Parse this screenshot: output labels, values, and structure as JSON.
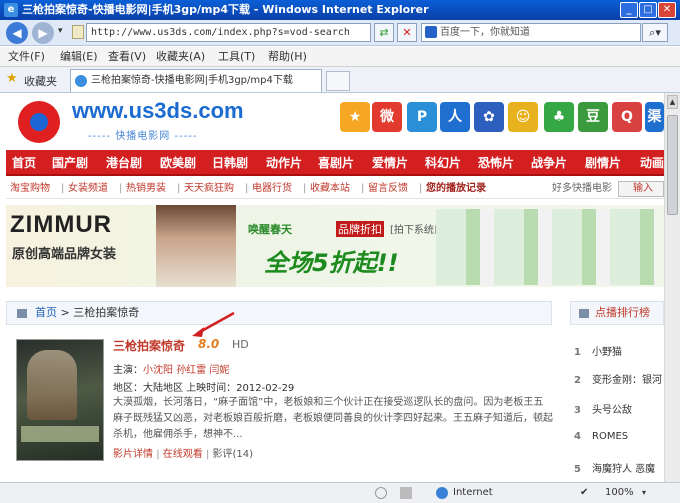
{
  "window": {
    "title": "三枪拍案惊奇-快播电影网|手机3gp/mp4下载 - Windows Internet Explorer"
  },
  "address_bar": {
    "url": "http://www.us3ds.com/index.php?s=vod-search",
    "search_placeholder": "百度一下，你就知道"
  },
  "menu": [
    "文件(F)",
    "编辑(E)",
    "查看(V)",
    "收藏夹(A)",
    "工具(T)",
    "帮助(H)"
  ],
  "favorites": {
    "label": "收藏夹",
    "tab_title": "三枪拍案惊奇-快播电影网|手机3gp/mp4下载"
  },
  "site": {
    "url_text": "www.us3ds.com",
    "slogan": "----- 快播电影网 -----",
    "icons": [
      "qzone-icon",
      "weibo-icon",
      "pengyou-icon",
      "renren-icon",
      "baidu-icon",
      "sohu-icon",
      "kaixin-icon",
      "douban-icon",
      "tqq-icon",
      "more-icon"
    ],
    "icon_colors": [
      "#f5a623",
      "#e23a2e",
      "#2a8fd6",
      "#1f6fd0",
      "#2d5fbf",
      "#e8b21e",
      "#35a845",
      "#3b9a3b",
      "#d94040",
      "#1f6fd0"
    ],
    "icon_glyphs": [
      "★",
      "微",
      "P",
      "人",
      "✿",
      "☺",
      "♣",
      "豆",
      "Q",
      "渠"
    ]
  },
  "categories": [
    "首页",
    "国产剧",
    "港台剧",
    "欧美剧",
    "日韩剧",
    "动作片",
    "喜剧片",
    "爱情片",
    "科幻片",
    "恐怖片",
    "战争片",
    "剧情片",
    "动画"
  ],
  "subnav": {
    "links": [
      "淘宝购物",
      "女装频道",
      "热销男装",
      "天天疯狂购",
      "电器行货",
      "收藏本站",
      "留言反馈"
    ],
    "record": "您的播放记录",
    "right_label": "好多快播电影",
    "input_label": "输入"
  },
  "banner": {
    "brand": "ZIMMUR",
    "brand_sub": "原创高端品牌女装",
    "wake": "唤醒春天",
    "tag": "品牌折扣",
    "note": "[拍下系统自动减价]",
    "sale": "全场5折起!!"
  },
  "breadcrumb": {
    "home": "首页",
    "sep": " > ",
    "current": "三枪拍案惊奇"
  },
  "sidebar": {
    "title": "点播排行榜",
    "items": [
      {
        "rank": "1",
        "title": "小野猫"
      },
      {
        "rank": "2",
        "title": "变形金刚：银河"
      },
      {
        "rank": "3",
        "title": "头号公敌"
      },
      {
        "rank": "4",
        "title": "ROMES"
      },
      {
        "rank": "5",
        "title": "海魔狩人 恶魔"
      }
    ]
  },
  "movie": {
    "title": "三枪拍案惊奇",
    "score": "8.0",
    "quality": "HD",
    "cast_label": "主演：",
    "cast": [
      "小沈阳",
      "孙红雷",
      "闫妮"
    ],
    "region_line": "地区：大陆地区 上映时间：2012-02-29",
    "description": "大漠孤烟，长河落日，“麻子面馆”中，老板娘和三个伙计正在接受巡逻队长的盘问。因为老板王五麻子既残猛又凶恶，对老板娘百般折磨，老板娘便同善良的伙计李四好起来。王五麻子知道后，顿起杀机，他雇佣杀手，想神不...",
    "links": [
      "影片详情",
      "在线观看",
      "影评(14)"
    ]
  },
  "status": {
    "zone": "Internet",
    "zoom": "100%"
  }
}
